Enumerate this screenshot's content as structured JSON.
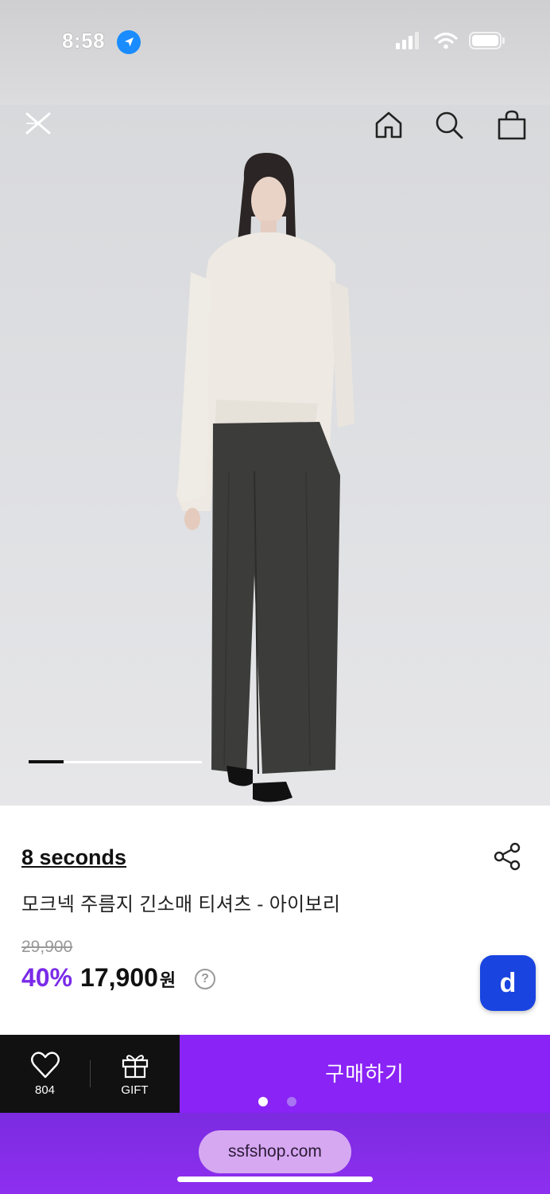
{
  "status_bar": {
    "time": "8:58"
  },
  "hero": {
    "carousel_progress": 0.2,
    "nav": {
      "back_icon": "close-icon",
      "home_icon": "home-icon",
      "search_icon": "search-icon",
      "bag_icon": "shopping-bag-icon"
    }
  },
  "product": {
    "brand": "8 seconds",
    "name": "모크넥 주름지 긴소매 티셔츠 - 아이보리",
    "original_price": "29,900",
    "discount": "40%",
    "price": "17,900",
    "currency": "원",
    "help_glyph": "?",
    "d_button": "d"
  },
  "actions": {
    "like_count": "804",
    "gift_label": "GIFT",
    "buy_label": "구매하기"
  },
  "browser": {
    "url": "ssfshop.com"
  },
  "colors": {
    "accent_purple": "#8a23f6",
    "discount_purple": "#7a2be8",
    "d_button_blue": "#1944e0"
  }
}
